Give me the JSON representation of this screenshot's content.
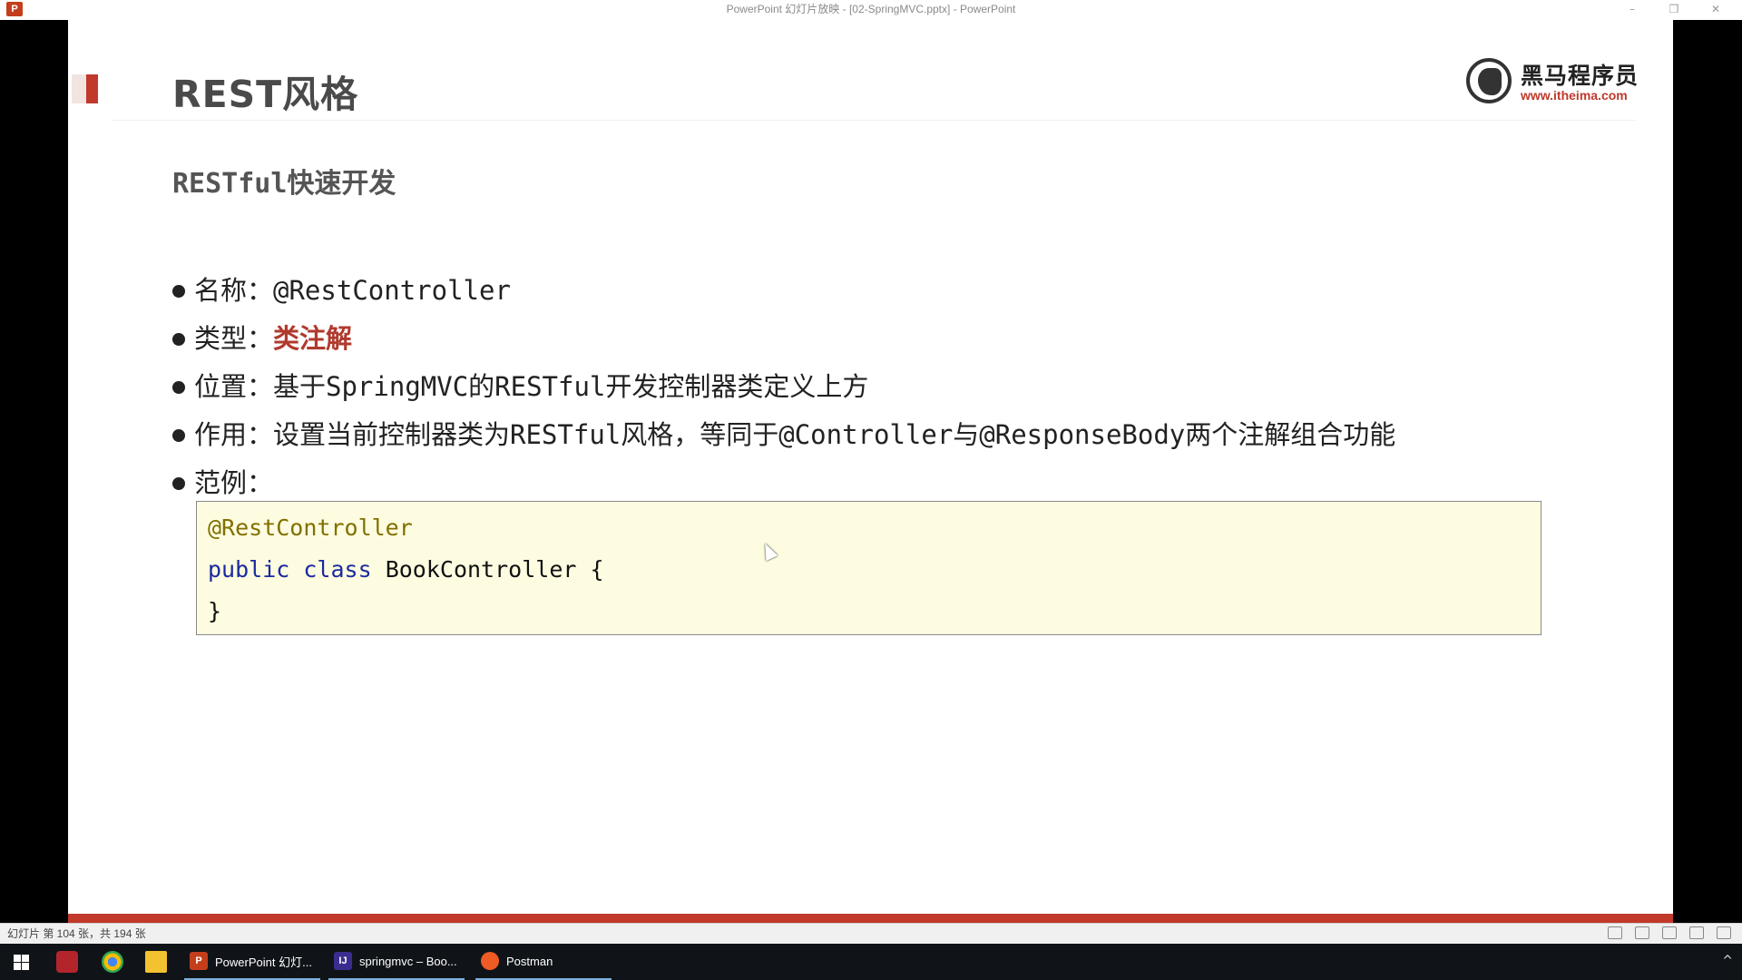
{
  "window": {
    "title": "PowerPoint 幻灯片放映 - [02-SpringMVC.pptx] - PowerPoint",
    "app_icon_letter": "P",
    "controls": [
      "–",
      "❐",
      "✕"
    ]
  },
  "slide": {
    "title": "REST风格",
    "subtitle": "RESTful快速开发",
    "logo": {
      "cn": "黑马程序员",
      "url": "www.itheima.com"
    },
    "bullets": [
      {
        "label": "名称：",
        "value": "@RestController"
      },
      {
        "label": "类型：",
        "value": "类注解"
      },
      {
        "label": "位置：",
        "value": "基于SpringMVC的RESTful开发控制器类定义上方"
      },
      {
        "label": "作用：",
        "value": "设置当前控制器类为RESTful风格，等同于@Controller与@ResponseBody两个注解组合功能"
      },
      {
        "label": "范例：",
        "value": ""
      }
    ],
    "code": {
      "annotation": "@RestController",
      "kw_public": "public",
      "kw_class": "class",
      "class_decl": "BookController {",
      "close": "}"
    },
    "colors": {
      "accent": "#c0392b",
      "code_bg": "#fefce0",
      "annotation": "#807000",
      "keyword": "#1a2aa0"
    }
  },
  "statusbar": {
    "text": "幻灯片 第 104 张，共 194 张"
  },
  "taskbar": {
    "apps": [
      {
        "label": "PowerPoint 幻灯...",
        "icon": "powerpoint-icon"
      },
      {
        "label": "springmvc – Boo...",
        "icon": "intellij-icon"
      },
      {
        "label": "Postman",
        "icon": "postman-icon"
      }
    ],
    "tray_chevron": "^"
  }
}
